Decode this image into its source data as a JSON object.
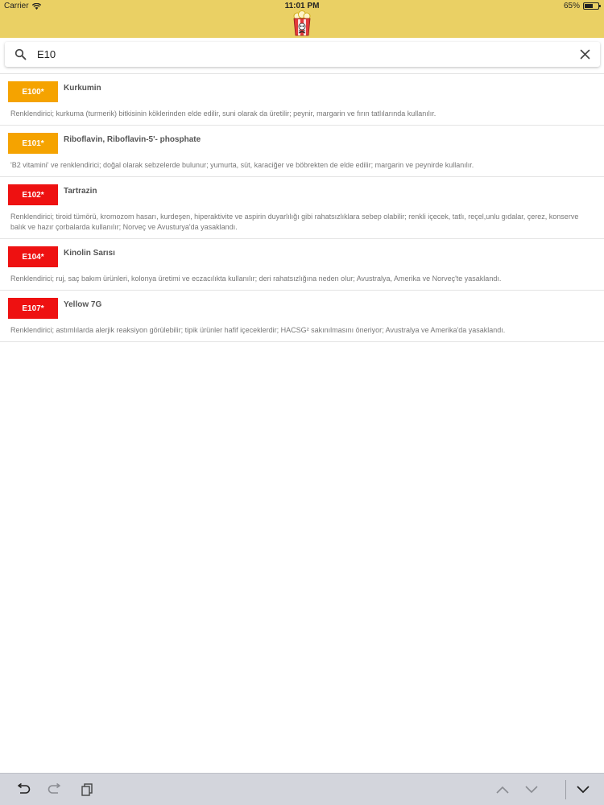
{
  "status_bar": {
    "carrier": "Carrier",
    "time": "11:01 PM",
    "battery_percent": "65%",
    "battery_level": 0.65
  },
  "header": {
    "logo_icon": "popcorn-skull-logo-icon",
    "background": "#ead064"
  },
  "search": {
    "value": "E10",
    "icons": {
      "search": "search-icon",
      "clear": "close-icon"
    }
  },
  "colors": {
    "orange_badge": "#f5a300",
    "red_badge": "#ee1111"
  },
  "results": [
    {
      "code": "E100*",
      "name": "Kurkumin",
      "badge_color": "#f5a300",
      "description": "Renklendirici; kurkuma (turmerik) bitkisinin köklerinden elde edilir, suni olarak da üretilir; peynir, margarin ve fırın tatlılarında kullanılır."
    },
    {
      "code": "E101*",
      "name": "Riboflavin, Riboflavin-5'- phosphate",
      "badge_color": "#f5a300",
      "description": "'B2 vitamini' ve renklendirici; doğal olarak sebzelerde bulunur; yumurta, süt, karaciğer ve böbrekten de elde edilir; margarin ve peynirde kullanılır."
    },
    {
      "code": "E102*",
      "name": "Tartrazin",
      "badge_color": "#ee1111",
      "description": "Renklendirici; tiroid tümörü, kromozom hasarı, kurdeşen, hiperaktivite ve aspirin duyarlılığı gibi rahatsızlıklara sebep olabilir; renkli içecek, tatlı, reçel,unlu gıdalar, çerez, konserve balık ve hazır çorbalarda kullanılır; Norveç ve Avusturya'da yasaklandı."
    },
    {
      "code": "E104*",
      "name": "Kinolin Sarısı",
      "badge_color": "#ee1111",
      "description": "Renklendirici; ruj, saç bakım ürünleri, kolonya üretimi ve eczacılıkta kullanılır; deri rahatsızlığına neden olur; Avustralya, Amerika ve Norveç'te yasaklandı."
    },
    {
      "code": "E107*",
      "name": "Yellow 7G",
      "badge_color": "#ee1111",
      "description": "Renklendirici; astımlılarda alerjik reaksiyon görülebilir; tipik ürünler hafif içeceklerdir; HACSG² sakınılmasını öneriyor; Avustralya ve Amerika'da yasaklandı."
    }
  ],
  "keyboard_toolbar": {
    "undo_icon": "undo-icon",
    "redo_icon": "redo-icon",
    "paste_icon": "paste-icon",
    "prev_icon": "chevron-up-icon",
    "next_icon": "chevron-down-icon",
    "dismiss_icon": "dismiss-keyboard-icon"
  }
}
